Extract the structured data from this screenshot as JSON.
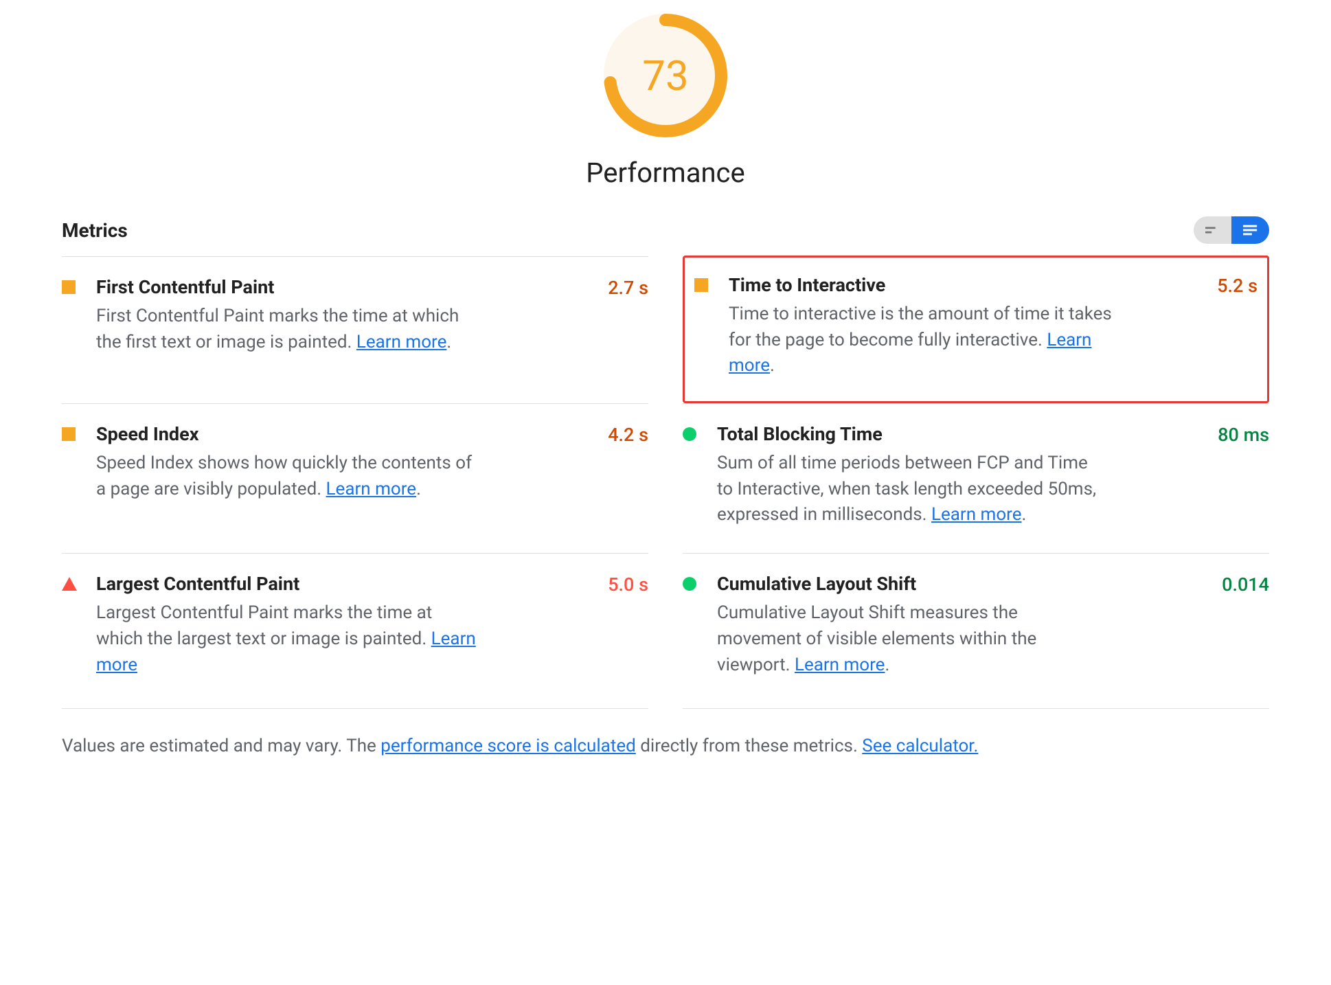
{
  "gauge": {
    "score": "73",
    "percent": 73,
    "title": "Performance",
    "color": "#f5a623"
  },
  "metrics_header": "Metrics",
  "learn_more_label": "Learn more",
  "metrics": [
    {
      "id": "fcp",
      "status": "square",
      "title": "First Contentful Paint",
      "desc": "First Contentful Paint marks the time at which the first text or image is painted. ",
      "value": "2.7 s",
      "value_class": "val-orange",
      "highlight": false
    },
    {
      "id": "tti",
      "status": "square",
      "title": "Time to Interactive",
      "desc": "Time to interactive is the amount of time it takes for the page to become fully interactive. ",
      "value": "5.2 s",
      "value_class": "val-orange",
      "highlight": true
    },
    {
      "id": "si",
      "status": "square",
      "title": "Speed Index",
      "desc": "Speed Index shows how quickly the contents of a page are visibly populated. ",
      "value": "4.2 s",
      "value_class": "val-orange",
      "highlight": false
    },
    {
      "id": "tbt",
      "status": "circle",
      "title": "Total Blocking Time",
      "desc": "Sum of all time periods between FCP and Time to Interactive, when task length exceeded 50ms, expressed in milliseconds. ",
      "value": "80 ms",
      "value_class": "val-green",
      "highlight": false
    },
    {
      "id": "lcp",
      "status": "triangle",
      "title": "Largest Contentful Paint",
      "desc": "Largest Contentful Paint marks the time at which the largest text or image is painted. ",
      "value": "5.0 s",
      "value_class": "val-red",
      "highlight": false,
      "no_period": true
    },
    {
      "id": "cls",
      "status": "circle",
      "title": "Cumulative Layout Shift",
      "desc": "Cumulative Layout Shift measures the movement of visible elements within the viewport. ",
      "value": "0.014",
      "value_class": "val-green",
      "highlight": false
    }
  ],
  "footnote": {
    "pre": "Values are estimated and may vary. The ",
    "link1": "performance score is calculated",
    "mid": " directly from these metrics. ",
    "link2": "See calculator."
  }
}
